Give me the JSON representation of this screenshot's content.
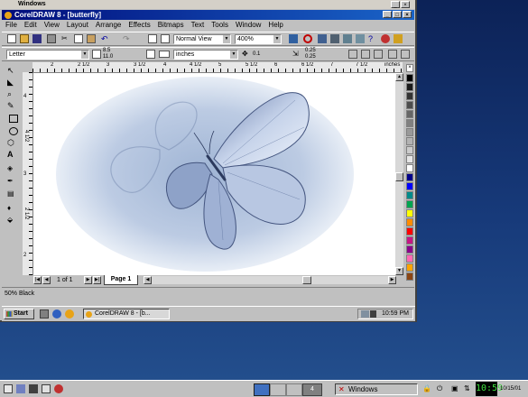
{
  "outer_window": {
    "title": "Windows"
  },
  "app": {
    "title": "CorelDRAW 8 - [butterfly]",
    "menu": [
      "File",
      "Edit",
      "View",
      "Layout",
      "Arrange",
      "Effects",
      "Bitmaps",
      "Text",
      "Tools",
      "Window",
      "Help"
    ]
  },
  "standard_toolbar": {
    "view_mode": "Normal View",
    "zoom": "400%"
  },
  "property_bar": {
    "paper_size": "Letter",
    "width": "8.5",
    "height": "11.0",
    "units": "inches",
    "nudge": "0.1",
    "dup_x": "0.25",
    "dup_y": "0.25"
  },
  "ruler": {
    "h_labels": [
      "2",
      "2 1/2",
      "3",
      "3 1/2",
      "4",
      "4 1/2",
      "5",
      "5 1/2",
      "6",
      "6 1/2",
      "7",
      "7 1/2"
    ],
    "units_label": "inches",
    "v_labels": [
      "4",
      "4 1/2",
      "3",
      "2 1/2",
      "2"
    ]
  },
  "palette_colors": [
    "#000000",
    "#1a1a1a",
    "#333333",
    "#4d4d4d",
    "#666666",
    "#808080",
    "#999999",
    "#b3b3b3",
    "#cccccc",
    "#e6e6e6",
    "#ffffff",
    "#00008b",
    "#0000ff",
    "#008b8b",
    "#00a550",
    "#ffff00",
    "#ff8c00",
    "#ff0000",
    "#c71585",
    "#8b008b",
    "#ff69b4",
    "#ffa500",
    "#8b4513"
  ],
  "page_nav": {
    "counter": "1 of 1",
    "tab": "Page 1"
  },
  "status": {
    "text": "50% Black"
  },
  "inner_taskbar": {
    "start_label": "Start",
    "task_label": "CorelDRAW 8 - [b...",
    "clock": "10:59 PM"
  },
  "bottom_taskbar": {
    "task_label": "Windows",
    "workspace_number": "4",
    "clock": "10:59",
    "date": "10/15/01"
  }
}
